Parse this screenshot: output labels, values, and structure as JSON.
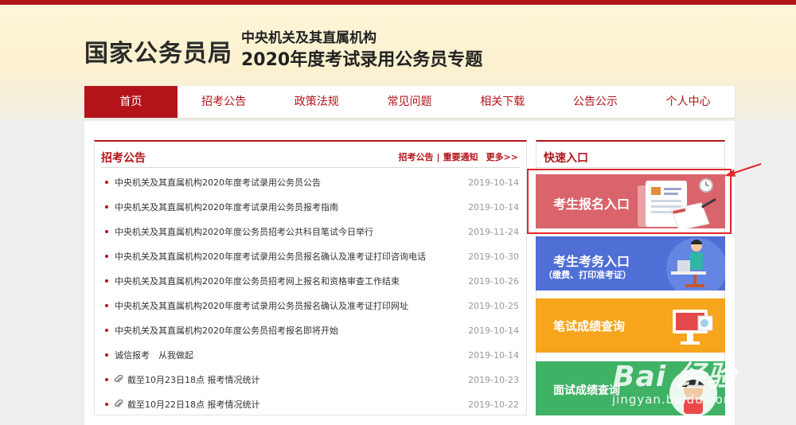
{
  "header": {
    "logo": "国家公务员局",
    "subtitle1": "中央机关及其直属机构",
    "subtitle2": "2020年度考试录用公务员专题"
  },
  "nav": {
    "items": [
      {
        "label": "首页",
        "active": true
      },
      {
        "label": "招考公告"
      },
      {
        "label": "政策法规"
      },
      {
        "label": "常见问题"
      },
      {
        "label": "相关下载"
      },
      {
        "label": "公告公示"
      },
      {
        "label": "个人中心"
      }
    ]
  },
  "news": {
    "title": "招考公告",
    "links": {
      "a": "招考公告",
      "sep": "|",
      "b": "重要通知",
      "more": "更多>>"
    },
    "items": [
      {
        "text": "中央机关及其直属机构2020年度考试录用公务员公告",
        "date": "2019-10-14"
      },
      {
        "text": "中央机关及其直属机构2020年度考试录用公务员报考指南",
        "date": "2019-10-14"
      },
      {
        "text": "中央机关及其直属机构2020年度公务员招考公共科目笔试今日举行",
        "date": "2019-11-24"
      },
      {
        "text": "中央机关及其直属机构2020年度考试录用公务员报名确认及准考证打印咨询电话",
        "date": "2019-10-30"
      },
      {
        "text": "中央机关及其直属机构2020年度公务员招考网上报名和资格审查工作结束",
        "date": "2019-10-26"
      },
      {
        "text": "中央机关及其直属机构2020年度考试录用公务员报名确认及准考证打印网址",
        "date": "2019-10-25"
      },
      {
        "text": "中央机关及其直属机构2020年度公务员招考报名即将开始",
        "date": "2019-10-14"
      },
      {
        "text": "诚信报考　从我做起",
        "date": "2019-10-14"
      },
      {
        "text": "截至10月23日18点 报考情况统计",
        "date": "2019-10-23"
      },
      {
        "text": "截至10月22日18点 报考情况统计",
        "date": "2019-10-22"
      }
    ]
  },
  "quick": {
    "title": "快速入口",
    "cards": [
      {
        "label": "考生报名入口",
        "color": "#d9646c"
      },
      {
        "label": "考生考务入口",
        "sub": "（缴费、打印准考证）",
        "color": "#4f6fd6"
      },
      {
        "label": "笔试成绩查询",
        "color": "#f6a51c"
      },
      {
        "label": "面试成绩查询",
        "color": "#3fb266"
      }
    ]
  },
  "watermark": {
    "line1": "Bai 经验",
    "line2": "jingyan.baidu.com"
  },
  "colors": {
    "brand": "#b3141a",
    "highlight": "#e2262c"
  },
  "icons": [
    "attachment-icon",
    "document-icon",
    "clock-icon",
    "person-desk-icon",
    "monitor-icon",
    "trophy-icon"
  ]
}
